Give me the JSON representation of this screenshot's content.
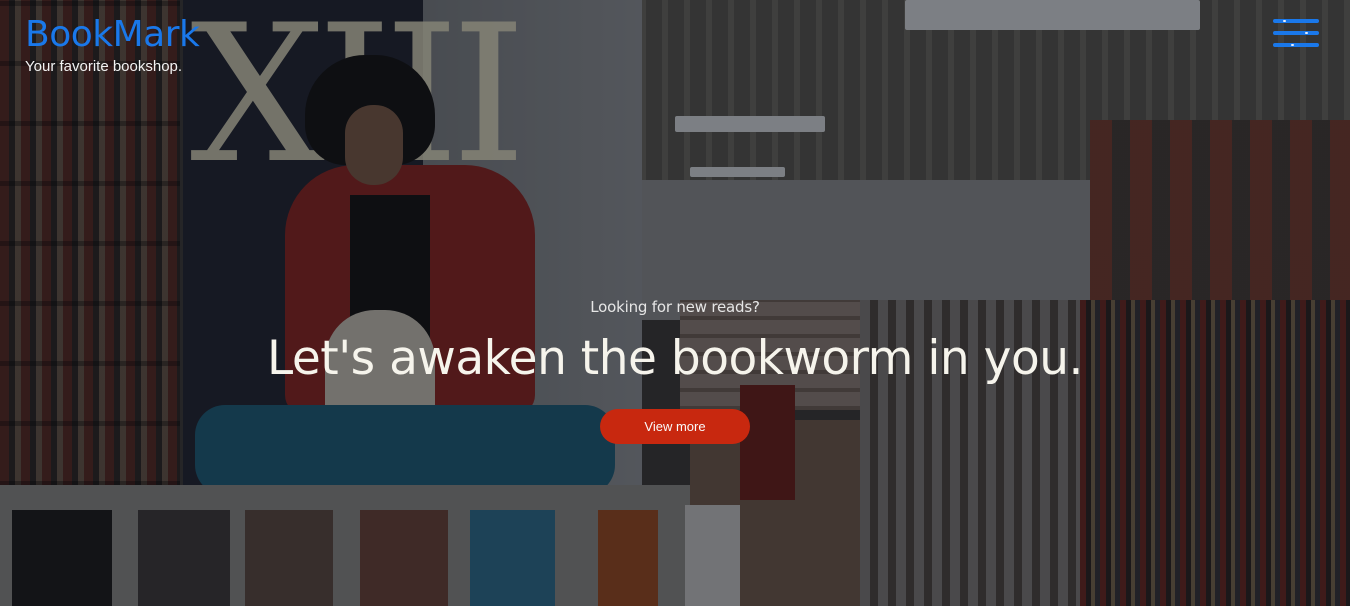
{
  "header": {
    "logo": "BookMark",
    "tagline": "Your favorite bookshop.",
    "menu_icon": "hamburger-menu-icon"
  },
  "hero": {
    "eyebrow": "Looking for new reads?",
    "headline": "Let's awaken the bookworm in you.",
    "cta_label": "View more",
    "background": "bookstore-interior-photo"
  },
  "colors": {
    "brand": "#1a78ea",
    "cta": "#c8280f",
    "headline_text": "#f6f4ec",
    "overlay": "rgba(10,14,20,0.45)"
  }
}
